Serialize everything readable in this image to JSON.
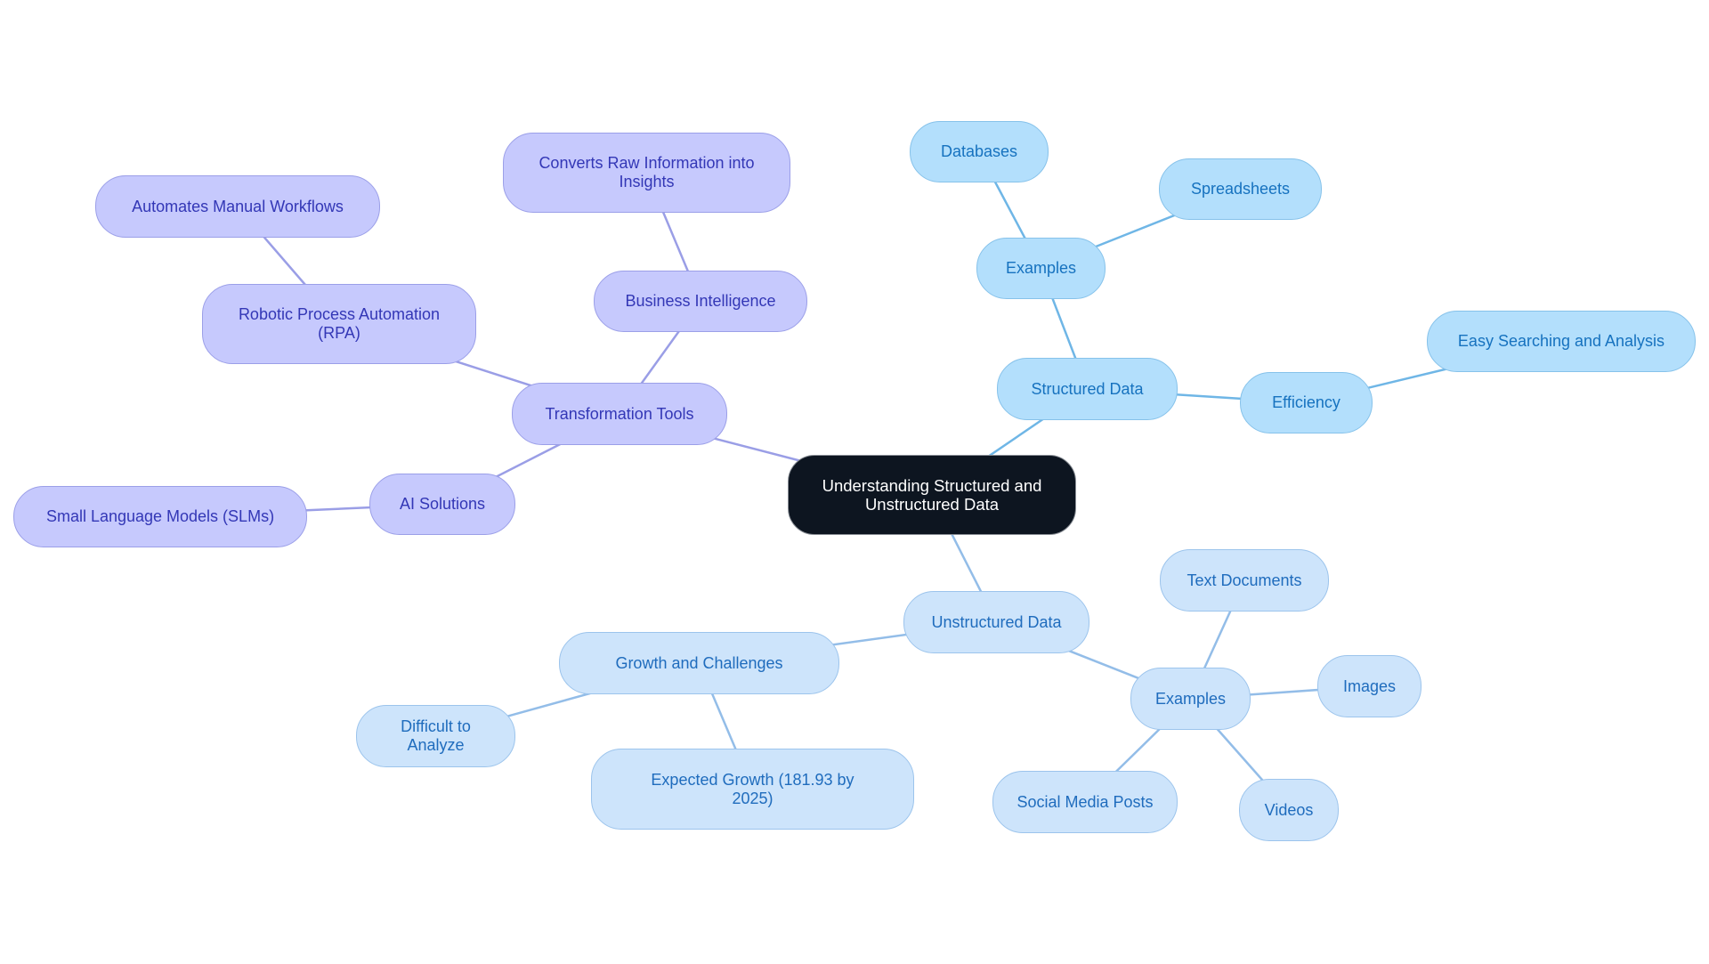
{
  "diagram": {
    "type": "mindmap",
    "colors": {
      "root_fill": "#0d1520",
      "root_text": "#ffffff",
      "transform_fill": "#c6c9fd",
      "transform_text": "#3337b6",
      "transform_edge": "#9a9ee6",
      "structured_fill": "#b3dffc",
      "structured_text": "#1672bf",
      "structured_edge": "#6fb6e6",
      "unstructured_fill": "#cde4fb",
      "unstructured_text": "#1f6cbd",
      "unstructured_edge": "#93bde8"
    },
    "root": {
      "id": "root",
      "label": "Understanding Structured and Unstructured Data"
    },
    "nodes": [
      {
        "id": "transformation-tools",
        "label": "Transformation Tools",
        "parent": "root",
        "group": "transform"
      },
      {
        "id": "business-intelligence",
        "label": "Business Intelligence",
        "parent": "transformation-tools",
        "group": "transform"
      },
      {
        "id": "converts-raw-information",
        "label": "Converts Raw Information into Insights",
        "parent": "business-intelligence",
        "group": "transform"
      },
      {
        "id": "rpa",
        "label": "Robotic Process Automation (RPA)",
        "parent": "transformation-tools",
        "group": "transform"
      },
      {
        "id": "automates-manual-workflows",
        "label": "Automates Manual Workflows",
        "parent": "rpa",
        "group": "transform"
      },
      {
        "id": "ai-solutions",
        "label": "AI Solutions",
        "parent": "transformation-tools",
        "group": "transform"
      },
      {
        "id": "small-language-models",
        "label": "Small Language Models (SLMs)",
        "parent": "ai-solutions",
        "group": "transform"
      },
      {
        "id": "structured-data",
        "label": "Structured Data",
        "parent": "root",
        "group": "structured"
      },
      {
        "id": "structured-examples",
        "label": "Examples",
        "parent": "structured-data",
        "group": "structured"
      },
      {
        "id": "databases",
        "label": "Databases",
        "parent": "structured-examples",
        "group": "structured"
      },
      {
        "id": "spreadsheets",
        "label": "Spreadsheets",
        "parent": "structured-examples",
        "group": "structured"
      },
      {
        "id": "efficiency",
        "label": "Efficiency",
        "parent": "structured-data",
        "group": "structured"
      },
      {
        "id": "easy-searching",
        "label": "Easy Searching and Analysis",
        "parent": "efficiency",
        "group": "structured"
      },
      {
        "id": "unstructured-data",
        "label": "Unstructured Data",
        "parent": "root",
        "group": "unstructured"
      },
      {
        "id": "unstructured-examples",
        "label": "Examples",
        "parent": "unstructured-data",
        "group": "unstructured"
      },
      {
        "id": "text-documents",
        "label": "Text Documents",
        "parent": "unstructured-examples",
        "group": "unstructured"
      },
      {
        "id": "images",
        "label": "Images",
        "parent": "unstructured-examples",
        "group": "unstructured"
      },
      {
        "id": "videos",
        "label": "Videos",
        "parent": "unstructured-examples",
        "group": "unstructured"
      },
      {
        "id": "social-media-posts",
        "label": "Social Media Posts",
        "parent": "unstructured-examples",
        "group": "unstructured"
      },
      {
        "id": "growth-and-challenges",
        "label": "Growth and Challenges",
        "parent": "unstructured-data",
        "group": "unstructured"
      },
      {
        "id": "difficult-to-analyze",
        "label": "Difficult to Analyze",
        "parent": "growth-and-challenges",
        "group": "unstructured"
      },
      {
        "id": "expected-growth",
        "label": "Expected Growth (181.93 by 2025)",
        "parent": "growth-and-challenges",
        "group": "unstructured"
      }
    ]
  }
}
